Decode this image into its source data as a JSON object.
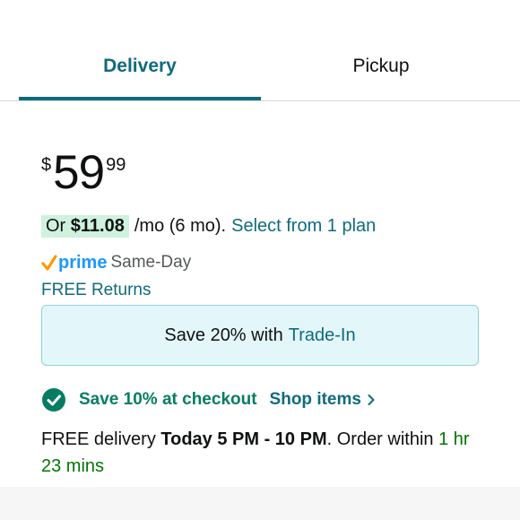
{
  "tabs": {
    "delivery_label": "Delivery",
    "pickup_label": "Pickup",
    "active": "Delivery"
  },
  "price": {
    "symbol": "$",
    "whole": "59",
    "fraction": "99"
  },
  "installment": {
    "prefix": "Or",
    "amount": "$11.08",
    "term": "/mo (6 mo).",
    "link": "Select from 1 plan"
  },
  "prime": {
    "badge": "prime",
    "speed": "Same-Day"
  },
  "returns": {
    "label": "FREE Returns"
  },
  "trade_in": {
    "text": "Save 20% with",
    "link": "Trade-In"
  },
  "coupon": {
    "text": "Save 10% at checkout",
    "link": "Shop items"
  },
  "delivery": {
    "prefix": "FREE delivery",
    "window": "Today 5 PM - 10 PM",
    "middle": ". Order within",
    "countdown": "1 hr 23 mins"
  },
  "colors": {
    "accent_teal": "#0f6b7d",
    "prime_blue": "#1a98ff",
    "prime_check": "#ff9900",
    "success_green": "#067d62",
    "countdown_green": "#007600",
    "installment_highlight": "#cef2dd",
    "trade_in_bg": "#e3f7fb"
  }
}
